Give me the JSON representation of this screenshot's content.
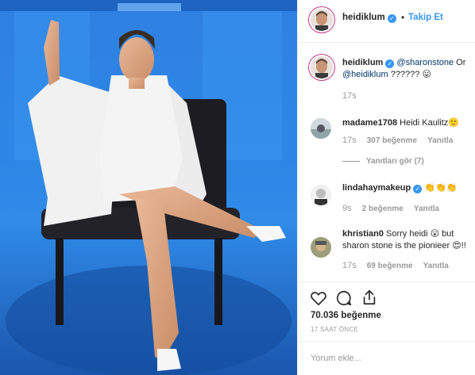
{
  "post": {
    "author": "heidiklum",
    "follow_label": "Takip Et",
    "separator": "•"
  },
  "comments": [
    {
      "username": "heidiklum",
      "verified": true,
      "parts": [
        "@sharonstone",
        " Or ",
        "@heidiklum",
        " ?????? 😛"
      ],
      "time": "17s",
      "likes": "",
      "reply": ""
    },
    {
      "username": "madame1708",
      "verified": false,
      "text": "Heidi Kaulitz🙂",
      "time": "17s",
      "likes": "307 beğenme",
      "reply": "Yanıtla",
      "view_replies": "Yanıtları gör (7)"
    },
    {
      "username": "lindahaymakeup",
      "verified": true,
      "text": "👏👏👏",
      "time": "9s",
      "likes": "2 beğenme",
      "reply": "Yanıtla"
    },
    {
      "username": "khristian0",
      "verified": false,
      "text": "Sorry heidi 😮 but sharon stone is the pionieer 😍!!",
      "time": "17s",
      "likes": "69 beğenme",
      "reply": "Yanıtla"
    }
  ],
  "stats": {
    "likes": "70.036 beğenme",
    "posted_ago": "17 SAAT ÖNCE"
  },
  "add_comment": {
    "placeholder": "Yorum ekle..."
  },
  "icons": {
    "like": "heart-icon",
    "comment": "comment-bubble-icon",
    "share": "share-icon",
    "verified": "verified-badge-icon"
  },
  "colors": {
    "link": "#3897f0",
    "verified": "#3897f0",
    "mention": "#003569",
    "muted": "#999999",
    "photo_bg": "#2f86e6"
  }
}
